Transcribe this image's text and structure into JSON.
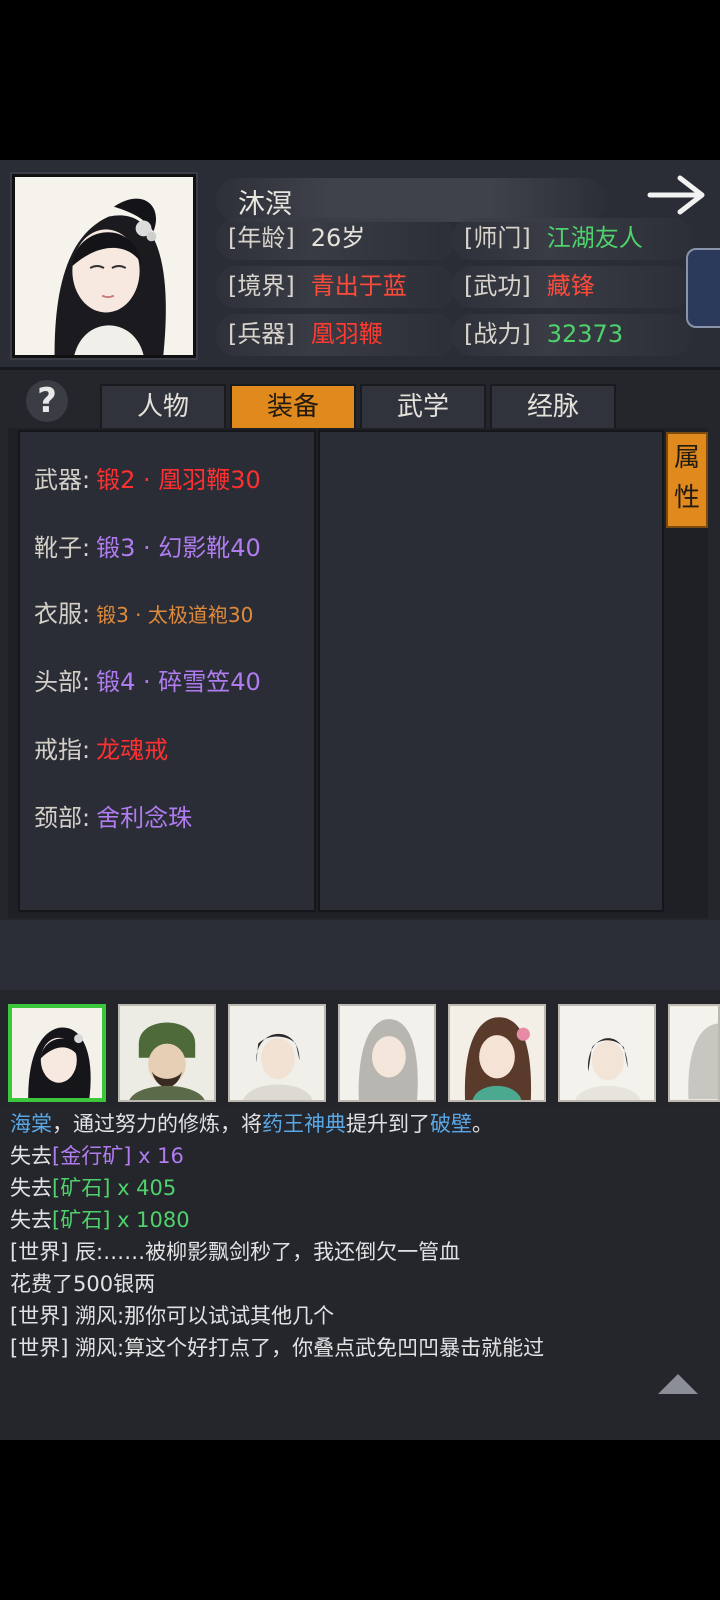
{
  "header": {
    "name": "沐溟",
    "stats": [
      {
        "label": "[年龄]",
        "value": "26岁",
        "color": "#e6e2da"
      },
      {
        "label": "[师门]",
        "value": "江湖友人",
        "color": "#4fd16b"
      },
      {
        "label": "[境界]",
        "value": "青出于蓝",
        "color": "#ff4a3a"
      },
      {
        "label": "[武功]",
        "value": "藏锋",
        "color": "#ff4a3a"
      },
      {
        "label": "[兵器]",
        "value": "凰羽鞭",
        "color": "#ff3a30"
      },
      {
        "label": "[战力]",
        "value": "32373",
        "color": "#4fd16b"
      }
    ]
  },
  "tabs": {
    "help": "?",
    "items": [
      "人物",
      "装备",
      "武学",
      "经脉"
    ],
    "active": "装备"
  },
  "attr_button": "属性",
  "equipment": [
    {
      "label": "武器:",
      "value": "锻2 · 凰羽鞭30",
      "color": "#ff3030"
    },
    {
      "label": "靴子:",
      "value": "锻3 · 幻影靴40",
      "color": "#b07cf0"
    },
    {
      "label": "衣服:",
      "value": "锻3 · 太极道袍30",
      "color": "#e08a3a"
    },
    {
      "label": "头部:",
      "value": "锻4 · 碎雪笠40",
      "color": "#b07cf0"
    },
    {
      "label": "戒指:",
      "value": "龙魂戒",
      "color": "#ff3030"
    },
    {
      "label": "颈部:",
      "value": "舍利念珠",
      "color": "#b07cf0"
    }
  ],
  "chat": {
    "line1": {
      "name": "海棠",
      "t1": "，通过努力的修炼，将",
      "skill": "药王神典",
      "t2": "提升到了",
      "level": "破壁",
      "t3": "。"
    },
    "line2": {
      "t1": "失去",
      "item": "[金行矿]",
      "qty": " x 16"
    },
    "line3": {
      "t1": "失去",
      "item": "[矿石]",
      "qty": " x 405"
    },
    "line4": {
      "t1": "失去",
      "item": "[矿石]",
      "qty": " x 1080"
    },
    "line5": "[世界] 辰:……被柳影飘剑秒了，我还倒欠一管血",
    "line6": "花费了500银两",
    "line7": "[世界] 溯风:那你可以试试其他几个",
    "line8": "[世界] 溯风:算这个好打点了，你叠点武免凹凹暴击就能过"
  }
}
